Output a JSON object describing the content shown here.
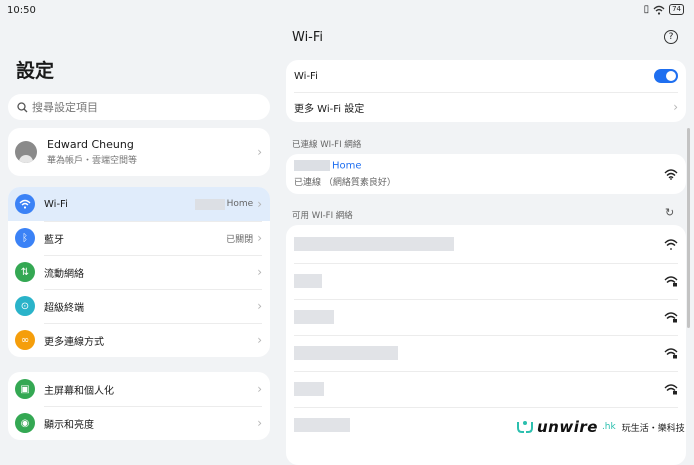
{
  "status": {
    "time": "10:50",
    "battery": "74"
  },
  "left": {
    "title": "設定",
    "search_placeholder": "搜尋設定項目",
    "account": {
      "name": "Edward Cheung",
      "sub": "華為帳戶・雲端空間等"
    },
    "group1": [
      {
        "label": "Wi-Fi",
        "value": "Home",
        "color": "#3b82f6",
        "icon": "wifi-icon"
      },
      {
        "label": "藍牙",
        "value": "已關閉",
        "color": "#3b82f6",
        "icon": "bluetooth-icon"
      },
      {
        "label": "流動網絡",
        "value": "",
        "color": "#34a853",
        "icon": "mobile-network-icon"
      },
      {
        "label": "超級終端",
        "value": "",
        "color": "#2ab3c9",
        "icon": "super-device-icon"
      },
      {
        "label": "更多連線方式",
        "value": "",
        "color": "#f59e0b",
        "icon": "link-icon"
      }
    ],
    "group2": [
      {
        "label": "主屏幕和個人化",
        "color": "#34a853",
        "icon": "home-screen-icon"
      },
      {
        "label": "顯示和亮度",
        "color": "#34a853",
        "icon": "display-icon"
      }
    ]
  },
  "right": {
    "title": "Wi-Fi",
    "wifi_label": "Wi-Fi",
    "wifi_enabled": true,
    "more_wifi": "更多 Wi-Fi 設定",
    "connected_header": "已連線 WI-FI 網絡",
    "connected": {
      "name": "Home",
      "status": "已連線 （網絡質素良好）"
    },
    "available_header": "可用 WI-FI 網絡"
  },
  "watermark": {
    "brand": "unwire",
    "domain": ".hk",
    "tagline": "玩生活・樂科技"
  }
}
